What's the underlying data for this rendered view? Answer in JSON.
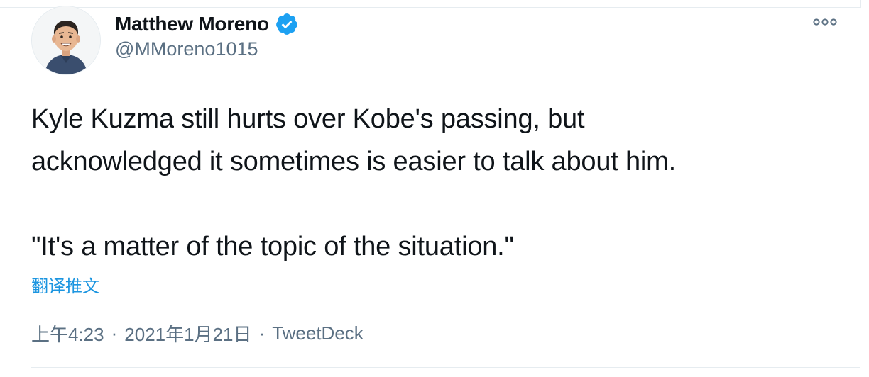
{
  "author": {
    "display_name": "Matthew Moreno",
    "handle": "@MMoreno1015",
    "verified": true,
    "avatar_icon": "avatar-cartoon-portrait"
  },
  "tweet": {
    "lines": [
      "Kyle Kuzma still hurts over Kobe's passing, but",
      "acknowledged it sometimes is easier to talk about him.",
      "\"It's a matter of the topic of the situation.\""
    ],
    "translate_label": "翻译推文",
    "time": "上午4:23",
    "date": "2021年1月21日",
    "source": "TweetDeck",
    "separator": "·"
  },
  "icons": {
    "verified": "verified-badge-icon",
    "more": "more-options-icon"
  },
  "colors": {
    "verified_blue": "#1da1f2",
    "link_blue": "#1b95e0",
    "secondary_text": "#5b7083",
    "primary_text": "#0f1419",
    "border": "#e6ecf0"
  }
}
